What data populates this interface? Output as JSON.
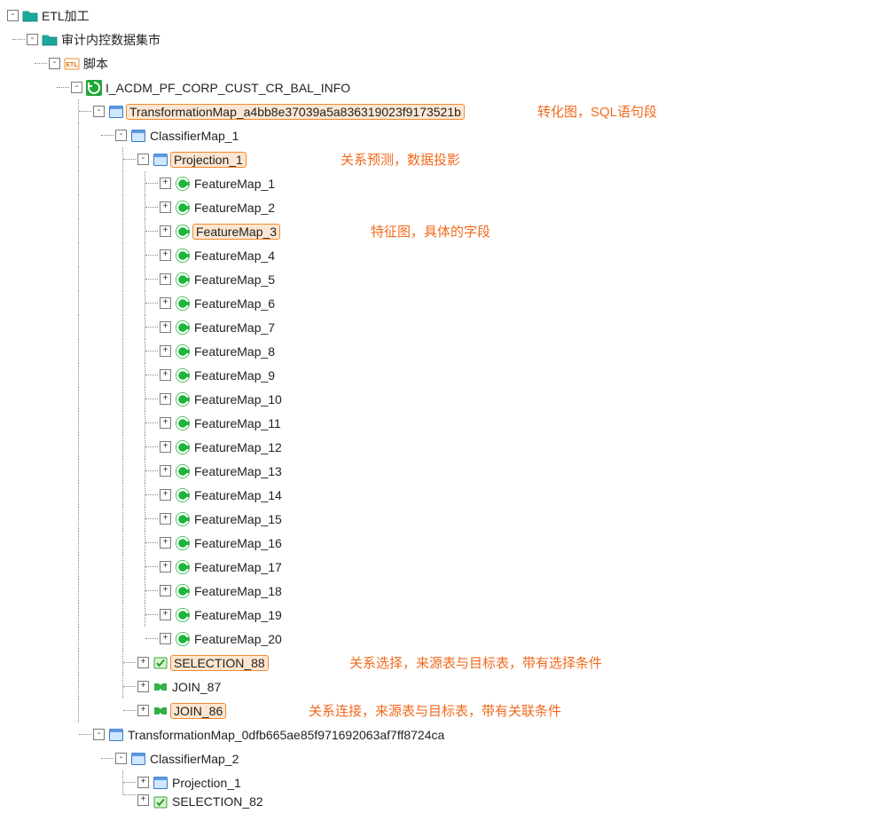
{
  "annotations": {
    "transform": "转化图，SQL语句段",
    "projection": "关系预测，数据投影",
    "feature": "特征图，具体的字段",
    "selection": "关系选择，来源表与目标表，带有选择条件",
    "join": "关系连接，来源表与目标表，带有关联条件"
  },
  "tree": [
    {
      "depth": 0,
      "toggle": "-",
      "icon": "folder-teal",
      "label": "ETL加工",
      "hl": false
    },
    {
      "depth": 1,
      "toggle": "-",
      "icon": "folder-teal",
      "label": "审计内控数据集市",
      "hl": false
    },
    {
      "depth": 2,
      "toggle": "-",
      "icon": "etl",
      "label": "脚本",
      "hl": false
    },
    {
      "depth": 3,
      "toggle": "-",
      "icon": "refresh-green",
      "label": "I_ACDM_PF_CORP_CUST_CR_BAL_INFO",
      "hl": false
    },
    {
      "depth": 4,
      "toggle": "-",
      "icon": "window",
      "label": "TransformationMap_a4bb8e37039a5a836319023f9173521b",
      "hl": true,
      "annot": "transform",
      "annotX": 602
    },
    {
      "depth": 5,
      "toggle": "-",
      "icon": "window",
      "label": "ClassifierMap_1",
      "hl": false
    },
    {
      "depth": 6,
      "toggle": "-",
      "icon": "window",
      "label": "Projection_1",
      "hl": true,
      "annot": "projection",
      "annotX": 380
    },
    {
      "depth": 7,
      "toggle": "+",
      "icon": "circle-c",
      "label": "FeatureMap_1",
      "hl": false
    },
    {
      "depth": 7,
      "toggle": "+",
      "icon": "circle-c",
      "label": "FeatureMap_2",
      "hl": false
    },
    {
      "depth": 7,
      "toggle": "+",
      "icon": "circle-c",
      "label": "FeatureMap_3",
      "hl": true,
      "annot": "feature",
      "annotX": 414
    },
    {
      "depth": 7,
      "toggle": "+",
      "icon": "circle-c",
      "label": "FeatureMap_4",
      "hl": false
    },
    {
      "depth": 7,
      "toggle": "+",
      "icon": "circle-c",
      "label": "FeatureMap_5",
      "hl": false
    },
    {
      "depth": 7,
      "toggle": "+",
      "icon": "circle-c",
      "label": "FeatureMap_6",
      "hl": false
    },
    {
      "depth": 7,
      "toggle": "+",
      "icon": "circle-c",
      "label": "FeatureMap_7",
      "hl": false
    },
    {
      "depth": 7,
      "toggle": "+",
      "icon": "circle-c",
      "label": "FeatureMap_8",
      "hl": false
    },
    {
      "depth": 7,
      "toggle": "+",
      "icon": "circle-c",
      "label": "FeatureMap_9",
      "hl": false
    },
    {
      "depth": 7,
      "toggle": "+",
      "icon": "circle-c",
      "label": "FeatureMap_10",
      "hl": false
    },
    {
      "depth": 7,
      "toggle": "+",
      "icon": "circle-c",
      "label": "FeatureMap_11",
      "hl": false
    },
    {
      "depth": 7,
      "toggle": "+",
      "icon": "circle-c",
      "label": "FeatureMap_12",
      "hl": false
    },
    {
      "depth": 7,
      "toggle": "+",
      "icon": "circle-c",
      "label": "FeatureMap_13",
      "hl": false
    },
    {
      "depth": 7,
      "toggle": "+",
      "icon": "circle-c",
      "label": "FeatureMap_14",
      "hl": false
    },
    {
      "depth": 7,
      "toggle": "+",
      "icon": "circle-c",
      "label": "FeatureMap_15",
      "hl": false
    },
    {
      "depth": 7,
      "toggle": "+",
      "icon": "circle-c",
      "label": "FeatureMap_16",
      "hl": false
    },
    {
      "depth": 7,
      "toggle": "+",
      "icon": "circle-c",
      "label": "FeatureMap_17",
      "hl": false
    },
    {
      "depth": 7,
      "toggle": "+",
      "icon": "circle-c",
      "label": "FeatureMap_18",
      "hl": false
    },
    {
      "depth": 7,
      "toggle": "+",
      "icon": "circle-c",
      "label": "FeatureMap_19",
      "hl": false
    },
    {
      "depth": 7,
      "toggle": "+",
      "icon": "circle-c",
      "label": "FeatureMap_20",
      "hl": false
    },
    {
      "depth": 6,
      "toggle": "+",
      "icon": "selection",
      "label": "SELECTION_88",
      "hl": true,
      "annot": "selection",
      "annotX": 390
    },
    {
      "depth": 6,
      "toggle": "+",
      "icon": "join",
      "label": "JOIN_87",
      "hl": false
    },
    {
      "depth": 6,
      "toggle": "+",
      "icon": "join",
      "label": "JOIN_86",
      "hl": true,
      "annot": "join",
      "annotX": 344
    },
    {
      "depth": 4,
      "toggle": "-",
      "icon": "window",
      "label": "TransformationMap_0dfb665ae85f971692063af7ff8724ca",
      "hl": false
    },
    {
      "depth": 5,
      "toggle": "-",
      "icon": "window",
      "label": "ClassifierMap_2",
      "hl": false
    },
    {
      "depth": 6,
      "toggle": "+",
      "icon": "window",
      "label": "Projection_1",
      "hl": false
    },
    {
      "depth": 6,
      "toggle": "+",
      "icon": "selection",
      "label": "SELECTION_82",
      "hl": false,
      "cut": true
    }
  ]
}
